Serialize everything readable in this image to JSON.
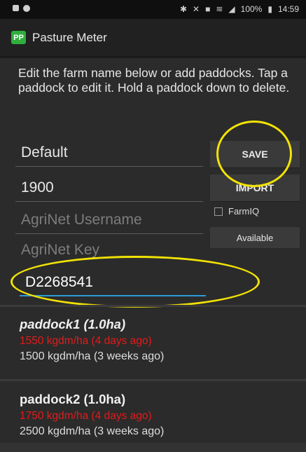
{
  "status_bar": {
    "time": "14:59",
    "battery": "100%",
    "icons": [
      "notification-icon",
      "notification-icon-2",
      "bluetooth-icon",
      "mute-icon",
      "data-icon",
      "wifi-icon",
      "signal-icon",
      "battery-icon"
    ]
  },
  "app": {
    "title": "Pasture Meter",
    "logo_text": "PP",
    "logo_color": "#2fae3d"
  },
  "instructions": "Edit the farm name below or add paddocks. Tap a paddock to edit it. Hold a paddock down to delete.",
  "form": {
    "farm_name": "Default",
    "number": "1900",
    "agrinet_username_placeholder": "AgriNet Username",
    "agrinet_key_placeholder": "AgriNet Key",
    "code": "D2268541"
  },
  "buttons": {
    "save": "SAVE",
    "import": "IMPORT",
    "available": "Available"
  },
  "farmiq": {
    "label": "FarmIQ",
    "checked": false
  },
  "paddocks": [
    {
      "name": "paddock1 (1.0ha)",
      "recent": "1550 kgdm/ha (4 days ago)",
      "older": "1500 kgdm/ha (3 weeks ago)"
    },
    {
      "name": "paddock2 (1.0ha)",
      "recent": "1750 kgdm/ha (4 days ago)",
      "older": "2500 kgdm/ha (3 weeks ago)"
    }
  ],
  "colors": {
    "highlight": "#f2e205",
    "recent_reading": "#e21b1b",
    "focus_underline": "#2e9bd6"
  }
}
